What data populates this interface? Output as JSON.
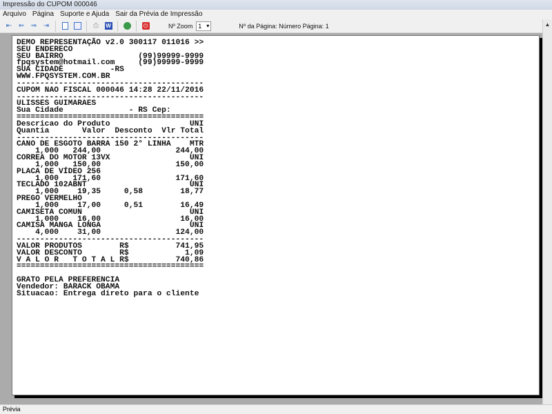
{
  "window": {
    "title": "Impressão do CUPOM 000046"
  },
  "menu": [
    "Arquivo",
    "Página",
    "Suporte e Ajuda",
    "Sair da Prévia de Impressão"
  ],
  "toolbar": {
    "zoom_label": "Nº Zoom",
    "zoom_value": "1",
    "page_info": "Nº da Página: Número Página: 1"
  },
  "receipt_lines": [
    "DEMO REPRESENTAÇÃO v2.0 300117 011016 >>",
    "SEU ENDERECO",
    "SEU BAIRRO                (99)99999-9999",
    "fpqsystem@hotmail.com     (99)99999-9999",
    "SUA CIDADE          -RS",
    "WWW.FPQSYSTEM.COM.BR",
    "----------------------------------------",
    "CUPOM NAO FISCAL 000046 14:28 22/11/2016",
    "----------------------------------------",
    "ULISSES GUIMARAES",
    "Sua Cidade              - RS Cep:",
    "========================================",
    "Descricao do Produto                 UNI",
    "Quantia       Valor  Desconto  Vlr Total",
    "----------------------------------------",
    "CANO DE ESGOTO BARRA 150 2° LINHA    MTR",
    "    1,000   244,00                244,00",
    "CORREA DO MOTOR 13VX                 UNI",
    "    1,000   150,00                150,00",
    "PLACA DE VÍDEO 256",
    "    1,000   171,60                171,60",
    "TECLADO 102ABNT                      UNI",
    "    1,000    19,35     0,58        18,77",
    "PREGO VERMELHO",
    "    1,000    17,00     0,51        16,49",
    "CAMISETA COMUN                       UNI",
    "    1,000    16,00                 16,00",
    "CAMISA MANGA LONGA                   UNI",
    "    4,000    31,00                124,00",
    "----------------------------------------",
    "VALOR PRODUTOS        R$          741,95",
    "VALOR DESCONTO        R$            1,09",
    "V A L O R   T O T A L R$          740,86",
    "========================================",
    "",
    "GRATO PELA PREFERENCIA",
    "Vendedor: BARACK OBAMA",
    "Situacao: Entrega direto para o cliente"
  ],
  "status": {
    "text": "Prévia"
  }
}
